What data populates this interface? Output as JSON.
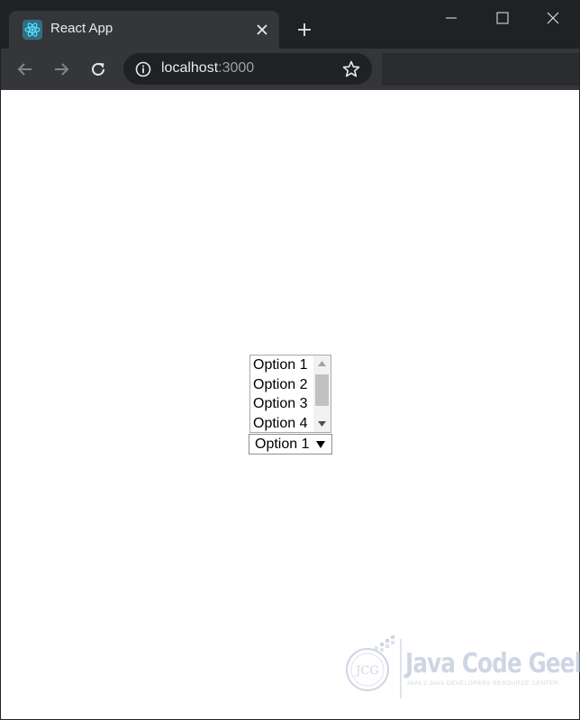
{
  "browser": {
    "tab_title": "React App",
    "favicon": "react-logo-icon",
    "url_host": "localhost",
    "url_port": ":3000",
    "colors": {
      "frame": "#202124",
      "toolbar": "#35363a",
      "text": "#e8eaed"
    }
  },
  "page": {
    "listbox": {
      "options": [
        "Option 1",
        "Option 2",
        "Option 3",
        "Option 4"
      ]
    },
    "dropdown": {
      "selected": "Option 1"
    }
  },
  "watermark": {
    "brand": "Java Code Geeks",
    "tagline": "JAVA 2 JAVA DEVELOPERS RESOURCE CENTER",
    "logo_text": "JCG"
  }
}
